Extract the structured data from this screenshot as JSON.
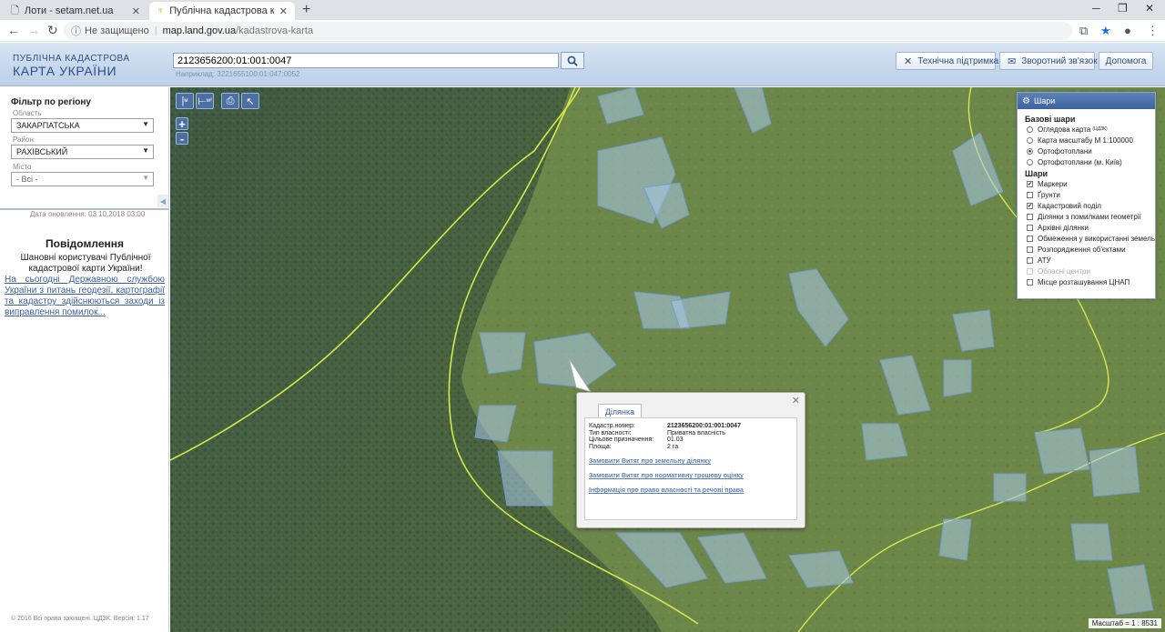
{
  "browser": {
    "tabs": [
      {
        "title": "Лоти - setam.net.ua"
      },
      {
        "title": "Публічна кадастрова карта Украї"
      }
    ],
    "address": {
      "security": "Не защищено",
      "host": "map.land.gov.ua",
      "path": "/kadastrova-karta"
    }
  },
  "header": {
    "logo_line1": "ПУБЛІЧНА КАДАСТРОВА",
    "logo_line2": "КАРТА УКРАЇНИ",
    "search_value": "2123656200:01:001:0047",
    "search_hint": "Наприклад: 3221655100:01:047:0052",
    "buttons": {
      "support": "Технічна підтримка",
      "feedback": "Зворотний зв'язок",
      "help": "Допомога"
    }
  },
  "sidebar": {
    "filter_title": "Фільтр по регіону",
    "oblast_label": "Область",
    "oblast_value": "ЗАКАРПАТСЬКА",
    "district_label": "Район",
    "district_value": "РАХІВСЬКИЙ",
    "city_label": "Місто",
    "city_value": "- Всі -",
    "updated": "Дата оновлення: 03.10.2018 03:00",
    "message_title": "Повідомлення",
    "message_text": "Шановні користувачі Публічної кадастрової карти України!",
    "message_link": "На сьогодні Державною службою України з питань геодезії, картографії та кадастру здійснюються заходи із виправлення помилок...",
    "copyright": "© 2016 Всі права захищені. ЦДЗК. Версія: 1.17"
  },
  "map": {
    "tools": {
      "ruler": "м",
      "area": "м²"
    },
    "zoom_in": "+",
    "zoom_out": "-",
    "scale": "Масштаб = 1 : 8531"
  },
  "layers": {
    "title": "Шари",
    "base_title": "Базові шари",
    "base": [
      {
        "label": "Оглядова карта",
        "sup": "(ЦДЗК)",
        "checked": false
      },
      {
        "label": "Карта масштабу М 1:100000",
        "checked": false
      },
      {
        "label": "Ортофотоплани",
        "checked": true
      },
      {
        "label": "Ортофотоплани (м. Київ)",
        "checked": false
      }
    ],
    "overlay_title": "Шари",
    "overlays": [
      {
        "label": "Маркери",
        "checked": true,
        "disabled": false
      },
      {
        "label": "Ґрунти",
        "checked": false,
        "disabled": false
      },
      {
        "label": "Кадастровий поділ",
        "checked": true,
        "disabled": false
      },
      {
        "label": "Ділянки з помилками геометрії",
        "checked": false,
        "disabled": false
      },
      {
        "label": "Архівні ділянки",
        "checked": false,
        "disabled": false
      },
      {
        "label": "Обмеження у використанні земель",
        "checked": false,
        "disabled": false
      },
      {
        "label": "Розпорядження об'єктами",
        "checked": false,
        "disabled": false
      },
      {
        "label": "АТУ",
        "checked": false,
        "disabled": false
      },
      {
        "label": "Обласні центри",
        "checked": false,
        "disabled": true
      },
      {
        "label": "Місце розташування ЦНАП",
        "checked": false,
        "disabled": false
      }
    ]
  },
  "popup": {
    "tab": "Ділянка",
    "fields": [
      {
        "key": "Кадастр.номер:",
        "value": "2123656200:01:001:0047",
        "bold": true
      },
      {
        "key": "Тип власності:",
        "value": "Приватна власність",
        "bold": false
      },
      {
        "key": "Цільове призначення:",
        "value": "01.03",
        "bold": false
      },
      {
        "key": "Площа:",
        "value": "2 га",
        "bold": false
      }
    ],
    "links": [
      "Замовити Витяг про земельну ділянку",
      "Замовити Витяг про нормативну грошову оцінку",
      "Інформація про право власності та речові права"
    ]
  },
  "colors": {
    "parcel_fill": "#a9c8e8",
    "parcel_stroke": "#6f9bd1",
    "boundary": "#d6e84a",
    "header_text": "#2b4f82"
  }
}
